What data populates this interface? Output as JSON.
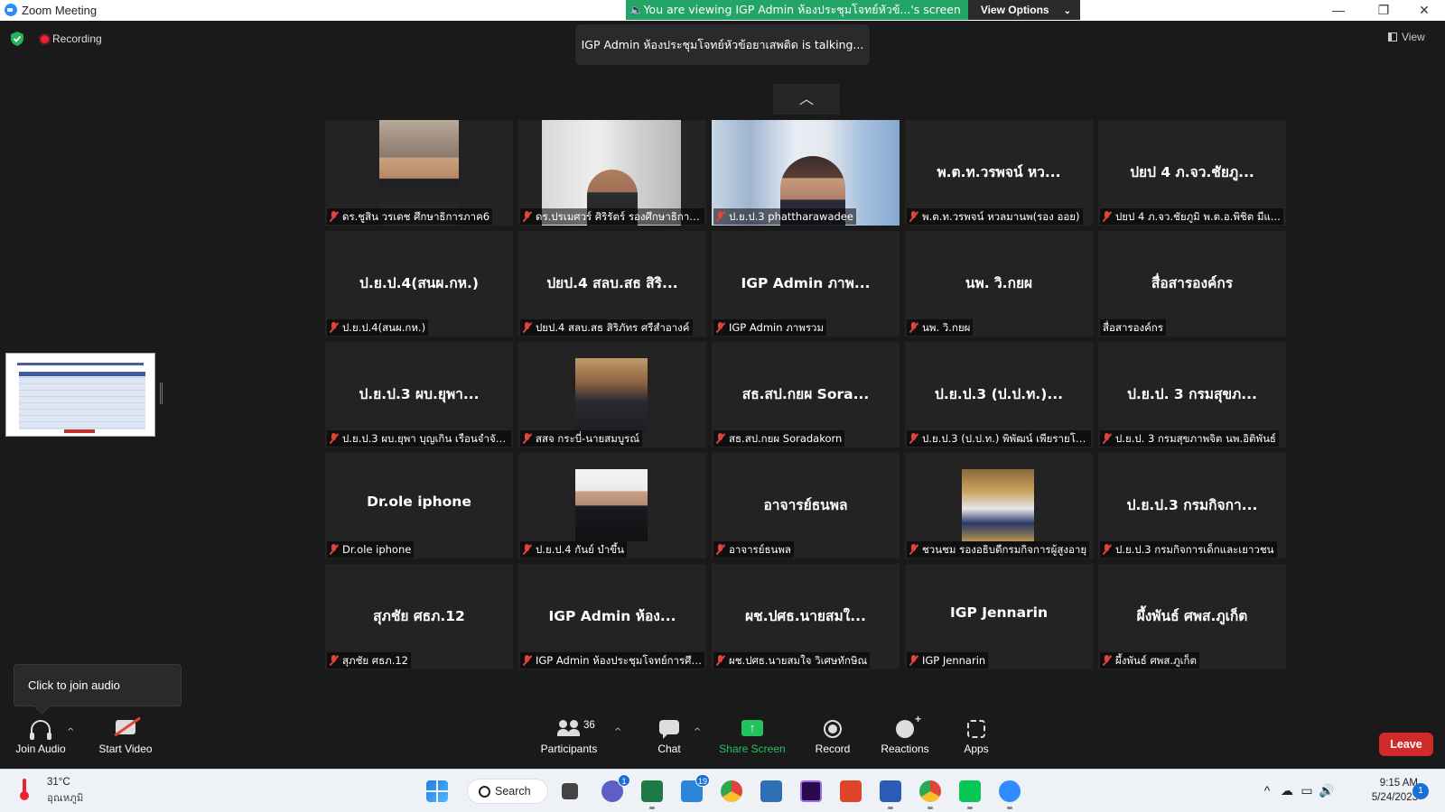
{
  "window": {
    "title": "Zoom Meeting",
    "minimize": "—",
    "maximize": "❐",
    "close": "✕"
  },
  "banner": {
    "viewing_text": "You are viewing IGP Admin ห้องประชุมโจทย์หัวข้...'s screen",
    "view_options": "View Options",
    "chevron": "⌄"
  },
  "top_overlay": {
    "recording_label": "Recording",
    "talking_text": "IGP Admin ห้องประชุมโจทย์หัวข้อยาเสพติด is talking...",
    "view_label": "View",
    "collapse_glyph": "︿"
  },
  "participants": [
    {
      "display": "",
      "name": "ดร.ชูสิน วรเดช ศึกษาธิการภาค6",
      "muted": true,
      "photo": "p1"
    },
    {
      "display": "",
      "name": "ดร.ปรเมศวร์ ศิริรัตร์ รองศึกษาธิการ...",
      "muted": true,
      "photo": "p2"
    },
    {
      "display": "",
      "name": "ป.ย.ป.3 phattharawadee",
      "muted": true,
      "photo": "p3"
    },
    {
      "display": "พ.ต.ท.วรพจน์ หว...",
      "name": "พ.ต.ท.วรพจน์ หวลมานพ(รอง ออย)",
      "muted": true,
      "photo": ""
    },
    {
      "display": "ปยป 4 ภ.จว.ชัยภู...",
      "name": "ปยป 4 ภ.จว.ชัยภูมิ พ.ต.อ.พิชิต  มีแ...",
      "muted": true,
      "photo": ""
    },
    {
      "display": "ป.ย.ป.4(สนผ.กห.)",
      "name": "ป.ย.ป.4(สนผ.กห.)",
      "muted": true,
      "photo": ""
    },
    {
      "display": "ปยป.4 สลบ.สธ สิริ...",
      "name": "ปยป.4 สลบ.สธ สิริภัทร ศรีสำอางค์",
      "muted": true,
      "photo": ""
    },
    {
      "display": "IGP Admin ภาพ...",
      "name": "IGP Admin ภาพรวม",
      "muted": true,
      "photo": ""
    },
    {
      "display": "นพ. วิ.กยผ",
      "name": "นพ. วิ.กยผ",
      "muted": true,
      "photo": ""
    },
    {
      "display": "สื่อสารองค์กร",
      "name": "สื่อสารองค์กร",
      "muted": false,
      "photo": ""
    },
    {
      "display": "ป.ย.ป.3 ผบ.ยุพา...",
      "name": "ป.ย.ป.3 ผบ.ยุพา บุญเกิน เรือนจำจัง...",
      "muted": true,
      "photo": ""
    },
    {
      "display": "",
      "name": "สสจ กระบี่-นายสมบูรณ์",
      "muted": true,
      "photo": "p4"
    },
    {
      "display": "สธ.สป.กยผ Sora...",
      "name": "สธ.สป.กยผ Soradakorn",
      "muted": true,
      "photo": ""
    },
    {
      "display": "ป.ย.ป.3 (ป.ป.ท.)...",
      "name": "ป.ย.ป.3 (ป.ป.ท.) พิพัฒน์ เพียรายโย...",
      "muted": true,
      "photo": ""
    },
    {
      "display": "ป.ย.ป. 3 กรมสุขภ...",
      "name": "ป.ย.ป. 3 กรมสุขภาพจิต นพ.อิติพันธ์",
      "muted": true,
      "photo": ""
    },
    {
      "display": "Dr.ole iphone",
      "name": "Dr.ole iphone",
      "muted": true,
      "photo": ""
    },
    {
      "display": "",
      "name": "ป.ย.ป.4 กันย์ บำขึ้น",
      "muted": true,
      "photo": "p5"
    },
    {
      "display": "อาจารย์ธนพล",
      "name": "อาจารย์ธนพล",
      "muted": true,
      "photo": ""
    },
    {
      "display": "",
      "name": "ชวนชม รองอธิบดีกรมกิจการผู้สูงอายุ",
      "muted": true,
      "photo": "p6"
    },
    {
      "display": "ป.ย.ป.3 กรมกิจกา...",
      "name": "ป.ย.ป.3 กรมกิจการเด็กและเยาวชน",
      "muted": true,
      "photo": ""
    },
    {
      "display": "สุภชัย ศธภ.12",
      "name": "สุภชัย ศธภ.12",
      "muted": true,
      "photo": ""
    },
    {
      "display": "IGP Admin ห้อง...",
      "name": "IGP Admin ห้องประชุมโจทย์การศึก...",
      "muted": true,
      "photo": ""
    },
    {
      "display": "ผช.ปศธ.นายสมใ...",
      "name": "ผช.ปศธ.นายสมใจ วิเศษทักษิณ",
      "muted": true,
      "photo": ""
    },
    {
      "display": "IGP Jennarin",
      "name": "IGP Jennarin",
      "muted": true,
      "photo": ""
    },
    {
      "display": "ผึ้งพันธ์ ศพส.ภูเก็ต",
      "name": "ผึ้งพันธ์ ศพส.ภูเก็ต",
      "muted": true,
      "photo": ""
    }
  ],
  "audio_tooltip": "Click to join audio",
  "toolbar": {
    "join_audio": "Join Audio",
    "start_video": "Start Video",
    "participants": "Participants",
    "participants_count": "36",
    "chat": "Chat",
    "share_screen": "Share Screen",
    "share_glyph": "↑",
    "record": "Record",
    "reactions": "Reactions",
    "apps": "Apps",
    "leave": "Leave",
    "caret": "^"
  },
  "taskbar": {
    "weather_temp": "31°C",
    "weather_label": "อุณหภูมิ",
    "search_label": "Search",
    "teams_badge": "1",
    "mail_badge": "19",
    "tray_icons": [
      "^",
      "☁",
      "▭",
      "🔊"
    ],
    "time": "9:15 AM",
    "date": "5/24/2023",
    "notifications": "1"
  },
  "colors": {
    "banner_green": "#23a566",
    "leave_red": "#d02a2a",
    "share_green": "#23c35b",
    "muted_red": "#e0443a"
  }
}
